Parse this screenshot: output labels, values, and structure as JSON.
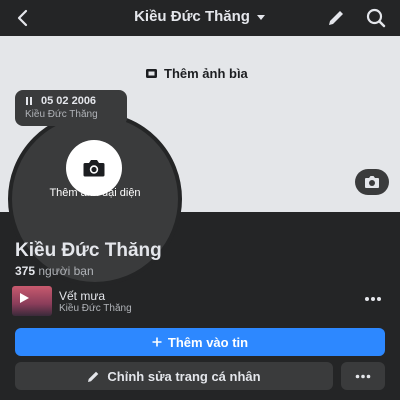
{
  "header": {
    "title": "Kiều Đức Thăng",
    "icons": [
      "back-icon",
      "chevron-down-icon",
      "pencil-icon",
      "search-icon"
    ]
  },
  "cover": {
    "add_cover_label": "Thêm ảnh bìa",
    "background": "#e4e6e9"
  },
  "avatar": {
    "add_photo_label": "Thêm ảnh đại diện"
  },
  "note": {
    "date": "05 02 2006",
    "author": "Kiều Đức Thăng"
  },
  "profile": {
    "name": "Kiều Đức Thăng",
    "friend_count": "375",
    "friend_label": " người bạn"
  },
  "music": {
    "song": "Vết mưa",
    "artist": "Kiều Đức Thăng"
  },
  "actions": {
    "add_story": "Thêm vào tin",
    "edit_profile": "Chỉnh sửa trang cá nhân"
  },
  "colors": {
    "primary": "#2d88ff",
    "background": "#242526",
    "surface": "#3a3b3c"
  }
}
